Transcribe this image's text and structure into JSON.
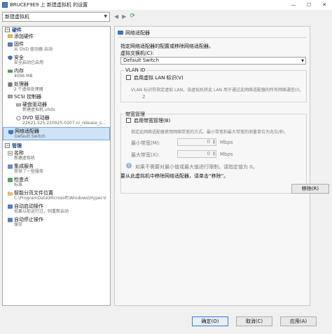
{
  "window": {
    "title": "BRUCEF9E9 上 新建虚拟机 的设置",
    "minimize_glyph": "—",
    "maximize_glyph": "☐",
    "close_glyph": "✕"
  },
  "vm_selector": {
    "value": "新建虚拟机"
  },
  "left_tree": {
    "hardware_header": "硬件",
    "hardware_toggle": "−",
    "add_hardware": {
      "label": "添加硬件"
    },
    "firmware": {
      "label": "固件",
      "sub": "从 DVD 驱动器 启动"
    },
    "security": {
      "label": "安全",
      "sub": "安全启动已启用"
    },
    "memory": {
      "label": "内存",
      "sub": "4096 MB"
    },
    "processor": {
      "label": "处理器",
      "sub": "2 个虚拟处理器"
    },
    "scsi": {
      "label": "SCSI 控制器"
    },
    "hard_drive": {
      "label": "硬盘驱动器",
      "sub": "新建虚拟机.vhdx"
    },
    "dvd_drive": {
      "label": "DVD 驱动器",
      "sub": "22621.525.220925-0207.ni_release_s..."
    },
    "network_adapter": {
      "label": "网络适配器",
      "sub": "Default Switch"
    },
    "management_header": "管理",
    "management_toggle": "−",
    "name": {
      "label": "名称",
      "sub": "新建虚拟机"
    },
    "integration": {
      "label": "集成服务",
      "sub": "提供了一些服务"
    },
    "checkpoints": {
      "label": "检查点",
      "sub": "标准"
    },
    "smart_paging": {
      "label": "智能分页文件位置",
      "sub": "C:\\ProgramData\\Microsoft\\Windows\\Hyper-V"
    },
    "auto_start": {
      "label": "自动启动操作",
      "sub": "如果以前运行过，则重新启动"
    },
    "auto_stop": {
      "label": "自动停止操作",
      "sub": "保存"
    }
  },
  "right_pane": {
    "header": "网络适配器",
    "description": "指定网络适配器的配置或移除网络适配器。",
    "switch_label": "虚拟交换机(C):",
    "switch_value": "Default Switch",
    "vlan": {
      "legend": "VLAN ID",
      "checkbox_label": "启用虚拟 LAN 标识(V)",
      "hint": "VLAN 标识符指定虚拟 LAN，该虚拟机将此 LAN 用于通过此网络适配器的所有网络通信(I)。",
      "value": "2"
    },
    "bandwidth": {
      "legend": "带宽管理",
      "checkbox_label": "启用带宽管理(B)",
      "hint": "指定此网络适配器使用网络带宽的方式。最小带宽和最大带宽的测量单位为兆位/秒。",
      "min_label": "最小带宽(M):",
      "min_value": "0",
      "max_label": "最大带宽(X):",
      "max_value": "0",
      "unit_min": "Mbps",
      "unit_max": "Mbps",
      "note": "如果不需要对最小值或最大值进行限制，请指定值为 0。"
    },
    "remove_hint": "要从此虚拟机中移除网络适配器，请单击“移除”。",
    "remove_button": "移除(R)"
  },
  "footer": {
    "ok": "确定(O)",
    "cancel": "取消(C)",
    "apply": "应用(A)"
  },
  "colors": {
    "selection": "#cde3f7",
    "section_header": "#1f3f7a",
    "refresh": "#2e9a3a"
  }
}
